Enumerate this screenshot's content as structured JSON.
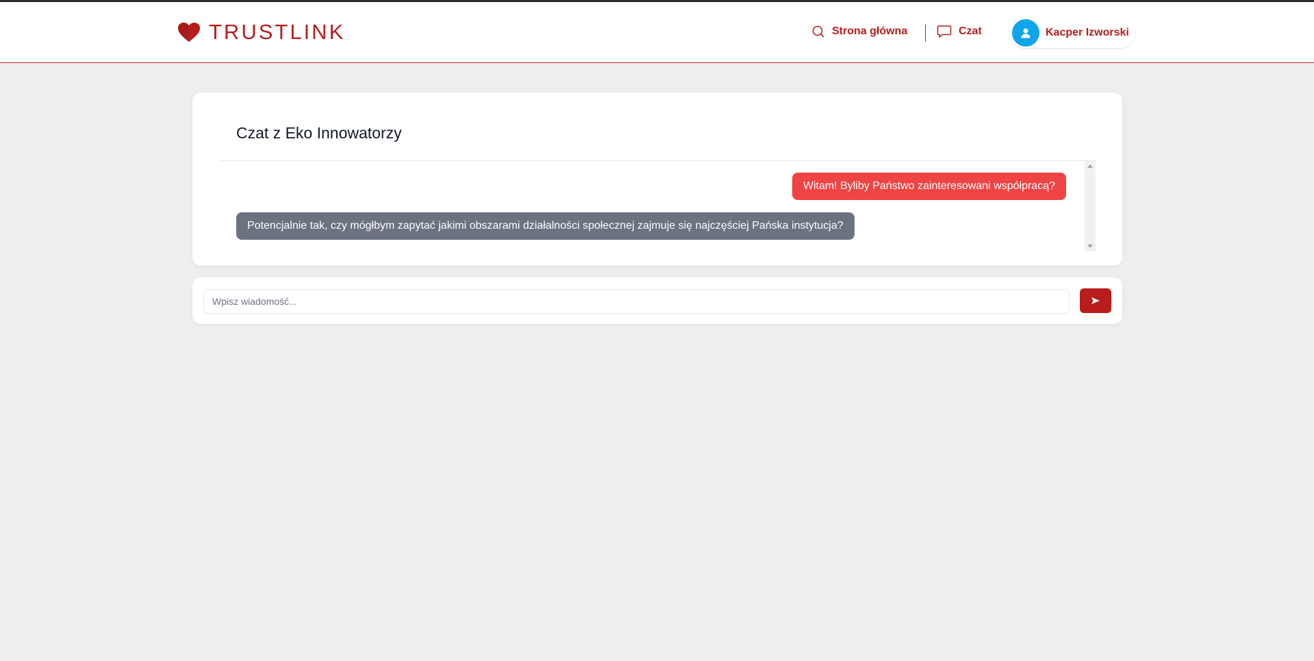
{
  "header": {
    "logo_text": "TRUSTLINK",
    "nav": {
      "home_label": "Strona główna",
      "chat_label": "Czat"
    },
    "user": {
      "name": "Kacper Izworski"
    }
  },
  "chat": {
    "title": "Czat z Eko Innowatorzy",
    "messages": [
      {
        "direction": "outgoing",
        "text": "Witam! Byliby Państwo zainteresowani współpracą?"
      },
      {
        "direction": "incoming",
        "text": "Potencjalnie tak, czy mógłbym zapytać jakimi obszarami działalności społecznej zajmuje się najczęściej Pańska instytucja?"
      }
    ]
  },
  "composer": {
    "placeholder": "Wpisz wiadomość...",
    "value": ""
  },
  "colors": {
    "brand": "#b91c1c",
    "outgoing_bubble": "#ef4444",
    "incoming_bubble": "#6b7280",
    "avatar": "#0ea5e9"
  },
  "icons": {
    "logo": "heart-icon",
    "home": "search-icon",
    "chat": "chat-bubble-icon",
    "user": "user-icon",
    "send": "send-icon"
  }
}
